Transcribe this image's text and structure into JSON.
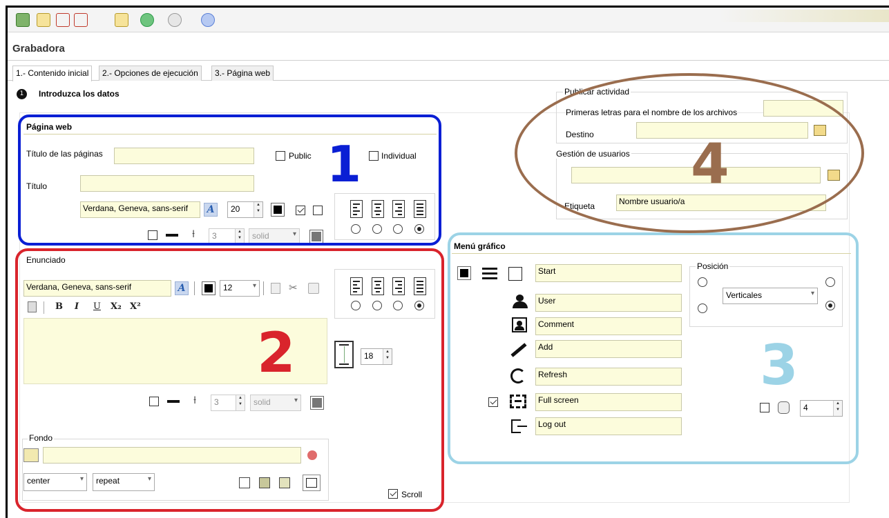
{
  "app": {
    "title": "Grabadora"
  },
  "toolbar": {
    "buttons": [
      {
        "name": "exit-icon",
        "color": "#3b7a2a"
      },
      {
        "name": "new-document-icon",
        "color": "#e8c94a"
      },
      {
        "name": "save-icon",
        "color": "#c0392b"
      },
      {
        "name": "save-as-icon",
        "color": "#c0392b"
      },
      {
        "name": "preview-icon",
        "color": "#e8c94a"
      },
      {
        "name": "web-icon",
        "color": "#2e9b4a"
      },
      {
        "name": "eye-icon",
        "color": "#888888"
      },
      {
        "name": "help-icon",
        "color": "#5a7fd6"
      }
    ]
  },
  "tabs": [
    "1.- Contenido inicial",
    "2.- Opciones de ejecución",
    "3.- Página web"
  ],
  "main": {
    "heading": "Introduzca los datos"
  },
  "pagina_web": {
    "title": "Página web",
    "titulo_paginas_label": "Título de las páginas",
    "titulo_paginas_value": "",
    "public_label": "Public",
    "individual_label": "Individual",
    "titulo_label": "Título",
    "titulo_value": "",
    "font_value": "Verdana, Geneva, sans-serif",
    "font_btn": "A",
    "font_size": "20",
    "border_width": "3",
    "border_style": "solid"
  },
  "enunciado": {
    "label": "Enunciado",
    "font_value": "Verdana, Geneva, sans-serif",
    "font_btn": "A",
    "font_size": "12",
    "line_height": "18",
    "border_width": "3",
    "border_style": "solid",
    "fondo_label": "Fondo",
    "fondo_value": "",
    "bg_position": "center",
    "bg_repeat": "repeat",
    "scroll_label": "Scroll",
    "rte": [
      "B",
      "I",
      "U",
      "X₂",
      "X²"
    ]
  },
  "publicar": {
    "title": "Publicar actividad",
    "prefix_label": "Primeras letras para el nombre de los archivos",
    "prefix_value": "",
    "destino_label": "Destino",
    "destino_value": ""
  },
  "usuarios": {
    "title": "Gestión de usuarios",
    "path_value": "",
    "etiqueta_label": "Etiqueta",
    "etiqueta_value": "Nombre usuario/a"
  },
  "menu_grafico": {
    "title": "Menú gráfico",
    "items": [
      {
        "icon": "user-icon",
        "value": "User"
      },
      {
        "icon": "comment-icon",
        "value": "Comment"
      },
      {
        "icon": "pencil-icon",
        "value": "Add"
      },
      {
        "icon": "refresh-icon",
        "value": "Refresh"
      },
      {
        "icon": "fullscreen-icon",
        "value": "Full screen"
      },
      {
        "icon": "logout-icon",
        "value": "Log out"
      }
    ],
    "start_value": "Start",
    "posicion_label": "Posición",
    "posicion_value": "Verticales",
    "radius_value": "4"
  },
  "overlays": {
    "one": "1",
    "two": "2",
    "three": "3",
    "four": "4",
    "colors": {
      "one": "#0a1fd4",
      "two": "#d9242c",
      "three": "#9cd3e6",
      "four": "#9a6d4e"
    }
  }
}
